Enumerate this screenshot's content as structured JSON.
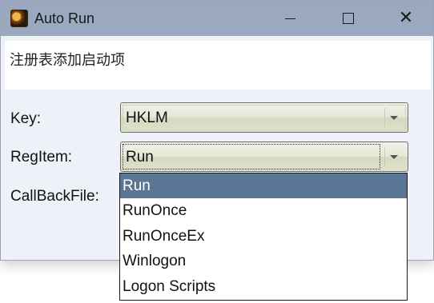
{
  "window": {
    "title": "Auto Run",
    "app_icon": "autorun-app-icon",
    "controls": {
      "minimize": "minimize-icon",
      "maximize": "maximize-icon",
      "close": "close-icon",
      "close_glyph": "✕"
    }
  },
  "description": "注册表添加启动项",
  "form": {
    "key_label": "Key:",
    "key_value": "HKLM",
    "regitem_label": "RegItem:",
    "regitem_value": "Run",
    "callback_label": "CallBackFile:"
  },
  "dropdown": {
    "options": [
      "Run",
      "RunOnce",
      "RunOnceEx",
      "Winlogon",
      "Logon Scripts"
    ],
    "selected": "Run",
    "selected_color": "#5b7594"
  },
  "colors": {
    "titlebar": "#9aa9bf",
    "window_bg": "#eef1f8"
  }
}
